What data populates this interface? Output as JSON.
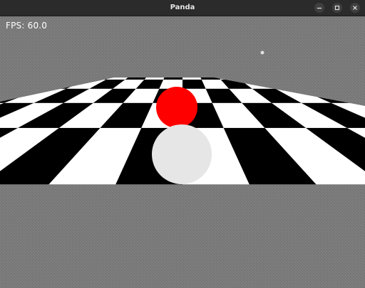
{
  "window": {
    "title": "Panda",
    "controls": {
      "minimize": "minimize-icon",
      "maximize": "maximize-icon",
      "close": "close-icon"
    }
  },
  "hud": {
    "fps_text": "FPS: 60.0"
  },
  "scene": {
    "background_color": "#7b7b7b",
    "floor": {
      "pattern": "checkerboard",
      "color_a": "#ffffff",
      "color_b": "#000000"
    },
    "objects": [
      {
        "name": "red-sphere",
        "color": "#ff0000"
      },
      {
        "name": "white-sphere",
        "color": "#e6e6e6"
      },
      {
        "name": "light-point",
        "color": "#e0e0e0"
      }
    ]
  }
}
